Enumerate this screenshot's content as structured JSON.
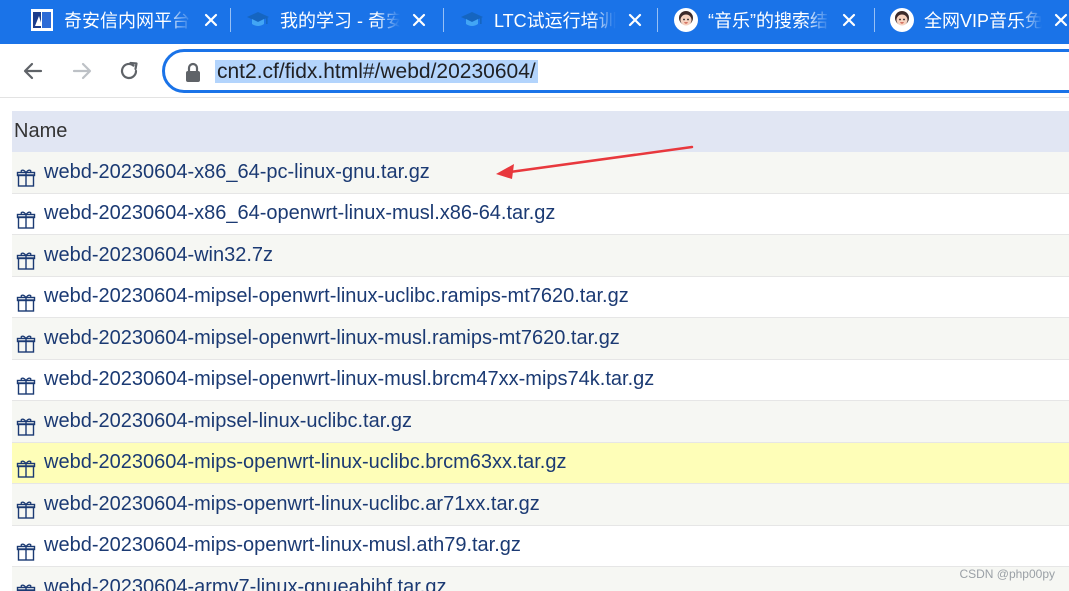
{
  "browser": {
    "tabs": [
      {
        "title": "奇安信内网平台",
        "icon": "shield-logo-icon"
      },
      {
        "title": "我的学习 - 奇安",
        "icon": "graduation-cap-icon"
      },
      {
        "title": "LTC试运行培训",
        "icon": "graduation-cap-icon"
      },
      {
        "title": "“音乐”的搜索结",
        "icon": "avatar-icon"
      },
      {
        "title": "全网VIP音乐免",
        "icon": "avatar-icon"
      }
    ],
    "url": "cnt2.cf/fidx.html#/webd/20230604/",
    "accent_color": "#1a73e8"
  },
  "listing": {
    "header": "Name",
    "files": [
      "webd-20230604-x86_64-pc-linux-gnu.tar.gz",
      "webd-20230604-x86_64-openwrt-linux-musl.x86-64.tar.gz",
      "webd-20230604-win32.7z",
      "webd-20230604-mipsel-openwrt-linux-uclibc.ramips-mt7620.tar.gz",
      "webd-20230604-mipsel-openwrt-linux-musl.ramips-mt7620.tar.gz",
      "webd-20230604-mipsel-openwrt-linux-musl.brcm47xx-mips74k.tar.gz",
      "webd-20230604-mipsel-linux-uclibc.tar.gz",
      "webd-20230604-mips-openwrt-linux-uclibc.brcm63xx.tar.gz",
      "webd-20230604-mips-openwrt-linux-uclibc.ar71xx.tar.gz",
      "webd-20230604-mips-openwrt-linux-musl.ath79.tar.gz",
      "webd-20230604-armv7-linux-gnueabihf.tar.gz"
    ],
    "highlight_color": "#fefeb8"
  },
  "annotation": {
    "arrow_color": "#e8383d"
  },
  "watermark": "CSDN @php00py"
}
